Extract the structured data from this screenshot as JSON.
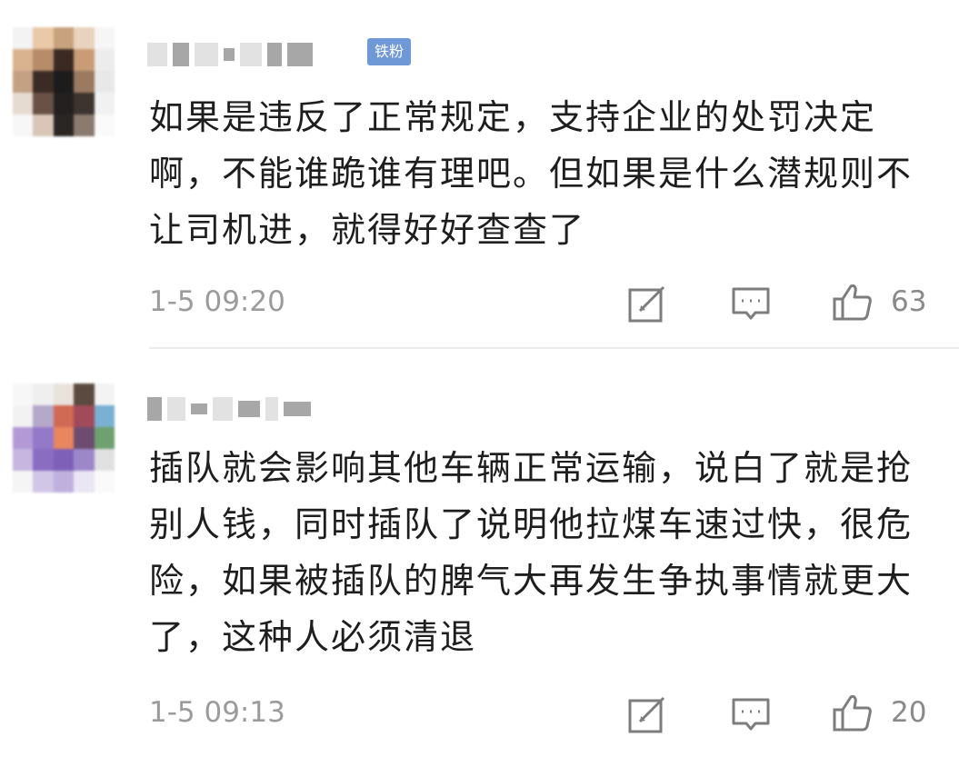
{
  "comments": [
    {
      "badge": "铁粉",
      "text": "如果是违反了正常规定，支持企业的处罚决定啊，不能谁跪谁有理吧。但如果是什么潜规则不让司机进，就得好好查查了",
      "time": "1-5 09:20",
      "likes": "63",
      "icons": {
        "edit": "share-edit-icon",
        "reply": "comment-icon",
        "like": "thumbs-up-icon"
      }
    },
    {
      "text": "插队就会影响其他车辆正常运输，说白了就是抢别人钱，同时插队了说明他拉煤车速过快，很危险，如果被插队的脾气大再发生争执事情就更大了，这种人必须清退",
      "time": "1-5 09:13",
      "likes": "20",
      "icons": {
        "edit": "share-edit-icon",
        "reply": "comment-icon",
        "like": "thumbs-up-icon"
      }
    }
  ]
}
